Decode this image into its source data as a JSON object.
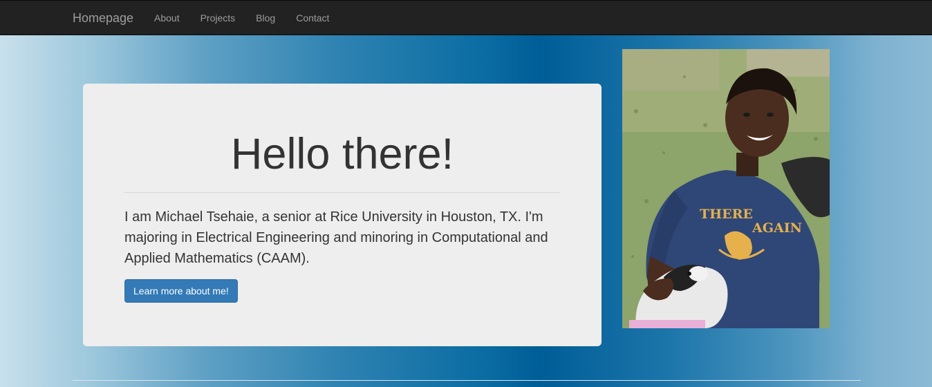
{
  "navbar": {
    "brand": "Homepage",
    "links": [
      {
        "label": "About"
      },
      {
        "label": "Projects"
      },
      {
        "label": "Blog"
      },
      {
        "label": "Contact"
      }
    ]
  },
  "hero": {
    "title": "Hello there!",
    "text": "I am Michael Tsehaie, a senior at Rice University in Houston, TX. I'm majoring in Electrical Engineering and minoring in Computational and Applied Mathematics (CAAM).",
    "button_label": "Learn more about me!"
  },
  "photo": {
    "shirt_text_left": "THERE",
    "shirt_text_right": "AGAIN"
  },
  "colors": {
    "navbar_bg": "#222222",
    "nav_text": "#9d9d9d",
    "jumbotron_bg": "#eeeeee",
    "primary_button": "#337ab7",
    "background_center": "#005d97"
  }
}
